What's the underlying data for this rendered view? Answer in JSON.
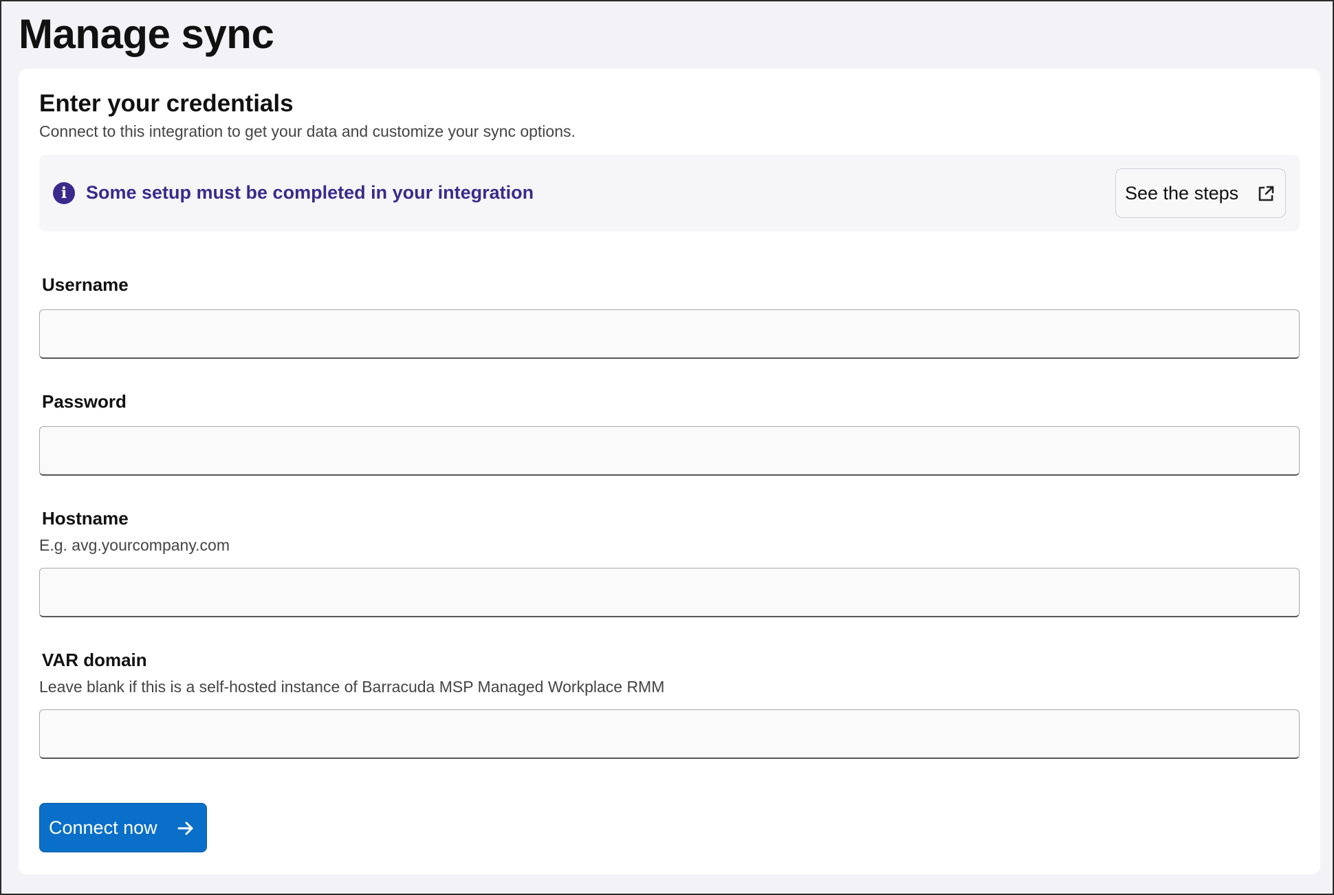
{
  "page": {
    "title": "Manage sync"
  },
  "card": {
    "title": "Enter your credentials",
    "subtitle": "Connect to this integration to get your data and customize your sync options."
  },
  "banner": {
    "icon": "info-icon",
    "icon_glyph": "i",
    "text": "Some setup must be completed in your integration",
    "button_label": "See the steps",
    "button_icon": "external-link-icon",
    "color": "#3b2a8c"
  },
  "form": {
    "username": {
      "label": "Username",
      "value": ""
    },
    "password": {
      "label": "Password",
      "value": ""
    },
    "hostname": {
      "label": "Hostname",
      "help": "E.g. avg.yourcompany.com",
      "value": ""
    },
    "var_domain": {
      "label": "VAR domain",
      "help": "Leave blank if this is a self-hosted instance of Barracuda MSP Managed Workplace RMM",
      "value": ""
    }
  },
  "actions": {
    "connect_label": "Connect now",
    "connect_icon": "arrow-right-icon",
    "connect_color": "#0a6fc9"
  }
}
